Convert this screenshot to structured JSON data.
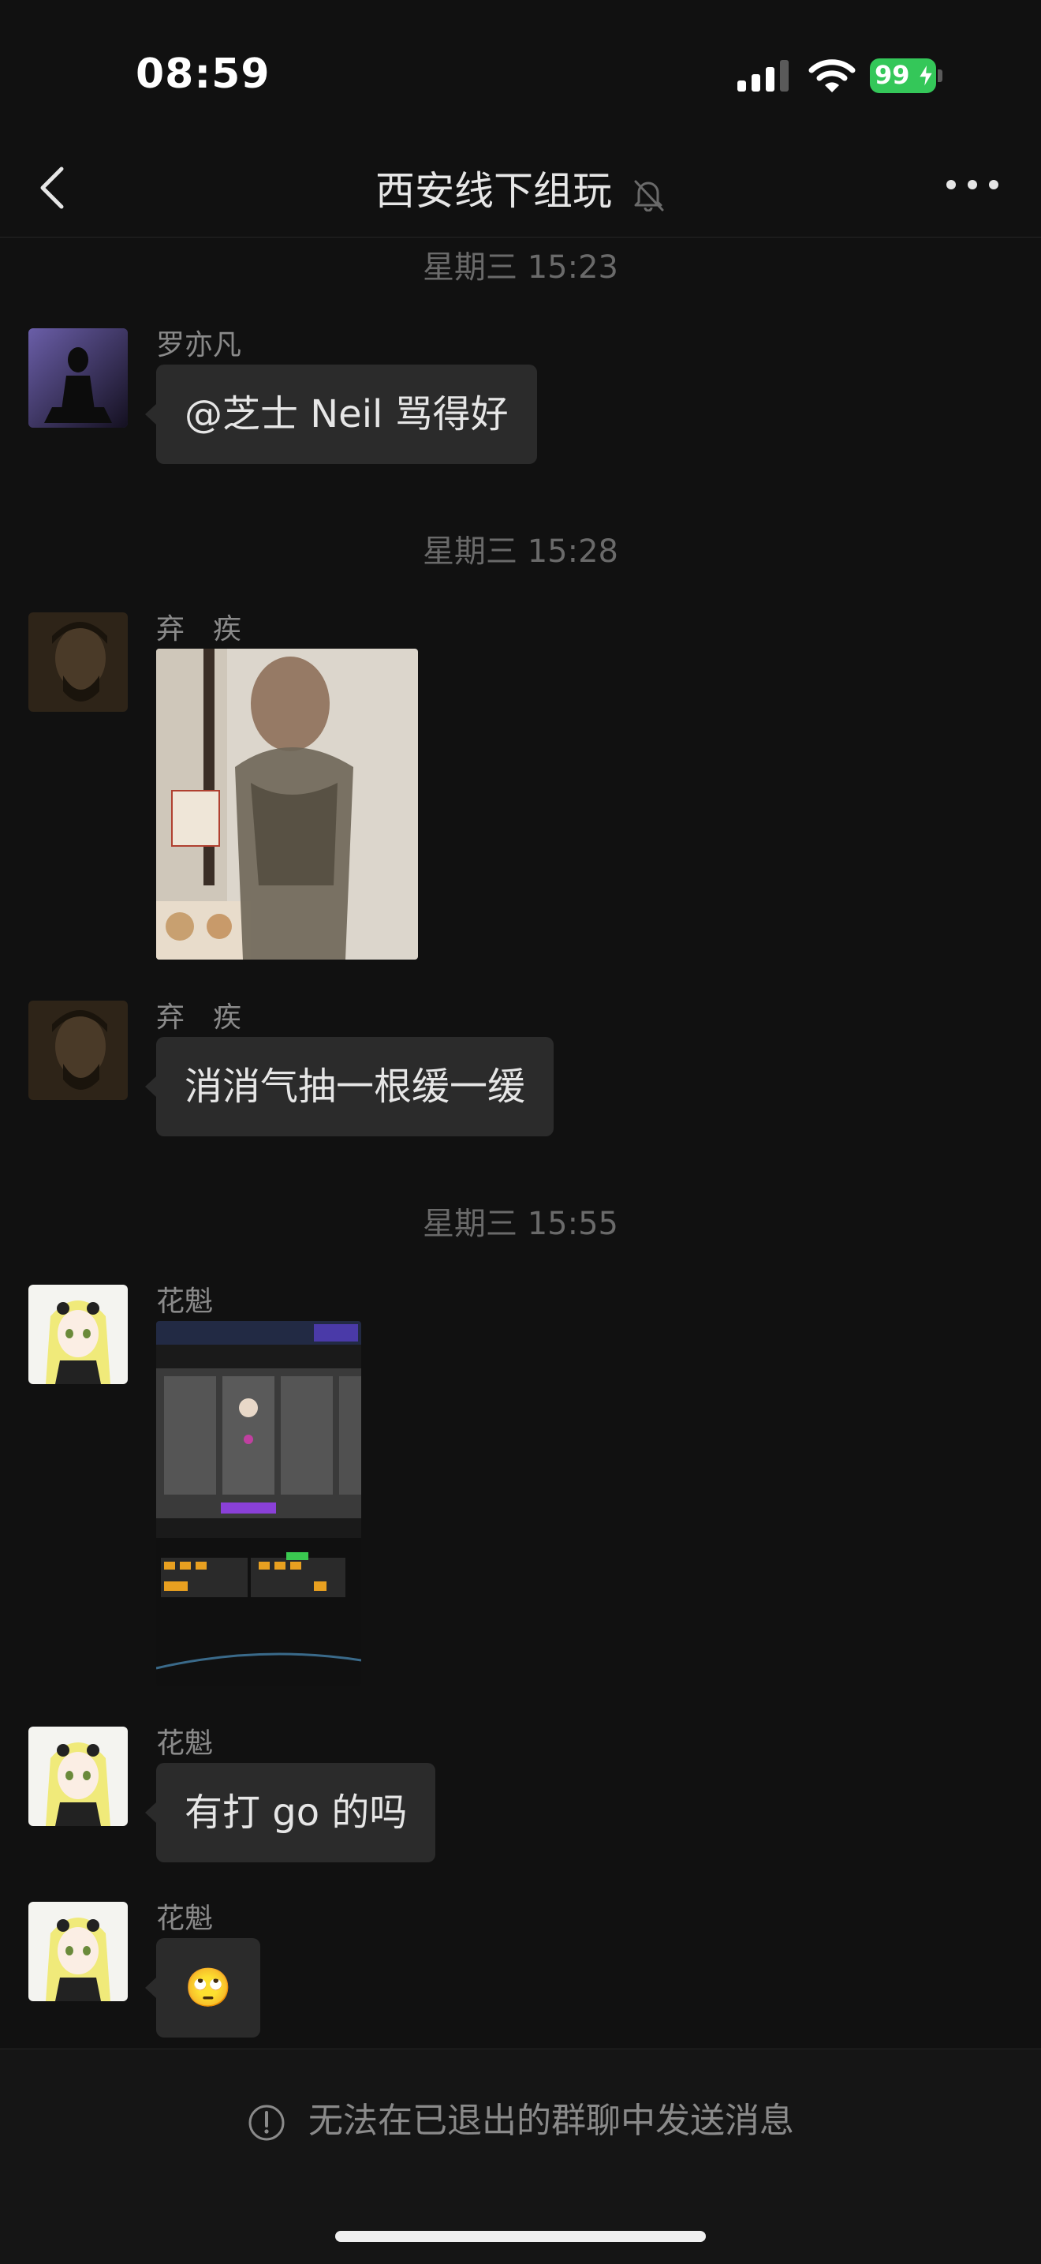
{
  "status_bar": {
    "time": "08:59",
    "battery": "99"
  },
  "nav": {
    "title": "西安线下组玩"
  },
  "messages": [
    {
      "timestamp": "星期三 15:23"
    },
    {
      "sender": "罗亦凡",
      "text": "@芝士 Neil 骂得好"
    },
    {
      "timestamp": "星期三 15:28"
    },
    {
      "sender": "弃　疾"
    },
    {
      "sender": "弃　疾",
      "text": "消消气抽一根缓一缓"
    },
    {
      "timestamp": "星期三 15:55"
    },
    {
      "sender": "花魁"
    },
    {
      "sender": "花魁",
      "text": "有打 go 的吗"
    },
    {
      "sender": "花魁",
      "text": "🙄"
    }
  ],
  "footer": {
    "notice": "无法在已退出的群聊中发送消息"
  },
  "colors": {
    "background": "#111111",
    "bubble": "#2b2b2b",
    "battery": "#34c759",
    "muted_text": "#8a8a8a"
  },
  "icons": [
    "back-icon",
    "mute-bell-icon",
    "more-icon",
    "signal-icon",
    "wifi-icon",
    "battery-icon",
    "warning-icon"
  ]
}
